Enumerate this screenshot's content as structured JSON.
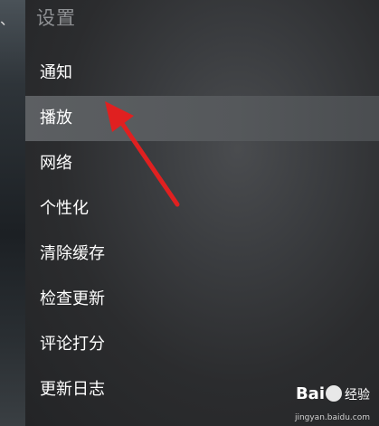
{
  "background": {
    "edge_text": "、"
  },
  "settings": {
    "title": "设置",
    "items": [
      {
        "label": "通知",
        "selected": false
      },
      {
        "label": "播放",
        "selected": true
      },
      {
        "label": "网络",
        "selected": false
      },
      {
        "label": "个性化",
        "selected": false
      },
      {
        "label": "清除缓存",
        "selected": false
      },
      {
        "label": "检查更新",
        "selected": false
      },
      {
        "label": "评论打分",
        "selected": false
      },
      {
        "label": "更新日志",
        "selected": false
      }
    ]
  },
  "annotation": {
    "arrow_color": "#e02020"
  },
  "watermark": {
    "logo_prefix": "Bai",
    "logo_suffix": "经验",
    "url": "jingyan.baidu.com"
  }
}
